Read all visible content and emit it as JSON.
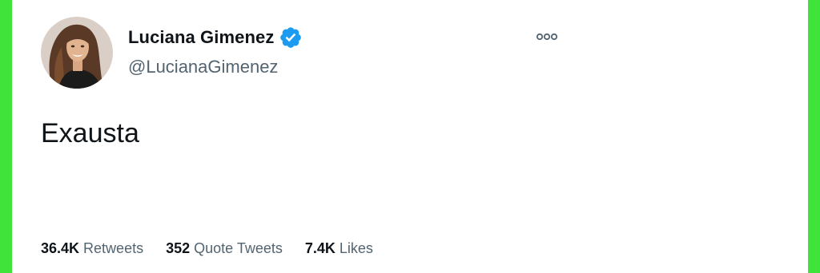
{
  "tweet": {
    "author": {
      "display_name": "Luciana Gimenez",
      "handle": "@LucianaGimenez",
      "verified": true,
      "avatar_icon": "profile-photo",
      "verified_icon": "verified-badge-icon"
    },
    "text": "Exausta",
    "more_icon": "more-options-icon",
    "stats": [
      {
        "count": "36.4K",
        "label": "Retweets"
      },
      {
        "count": "352",
        "label": "Quote Tweets"
      },
      {
        "count": "7.4K",
        "label": "Likes"
      }
    ]
  },
  "colors": {
    "frame": "#3fe33a",
    "text_primary": "#0f1419",
    "text_secondary": "#536471",
    "verified": "#1d9bf0",
    "background": "#ffffff"
  }
}
